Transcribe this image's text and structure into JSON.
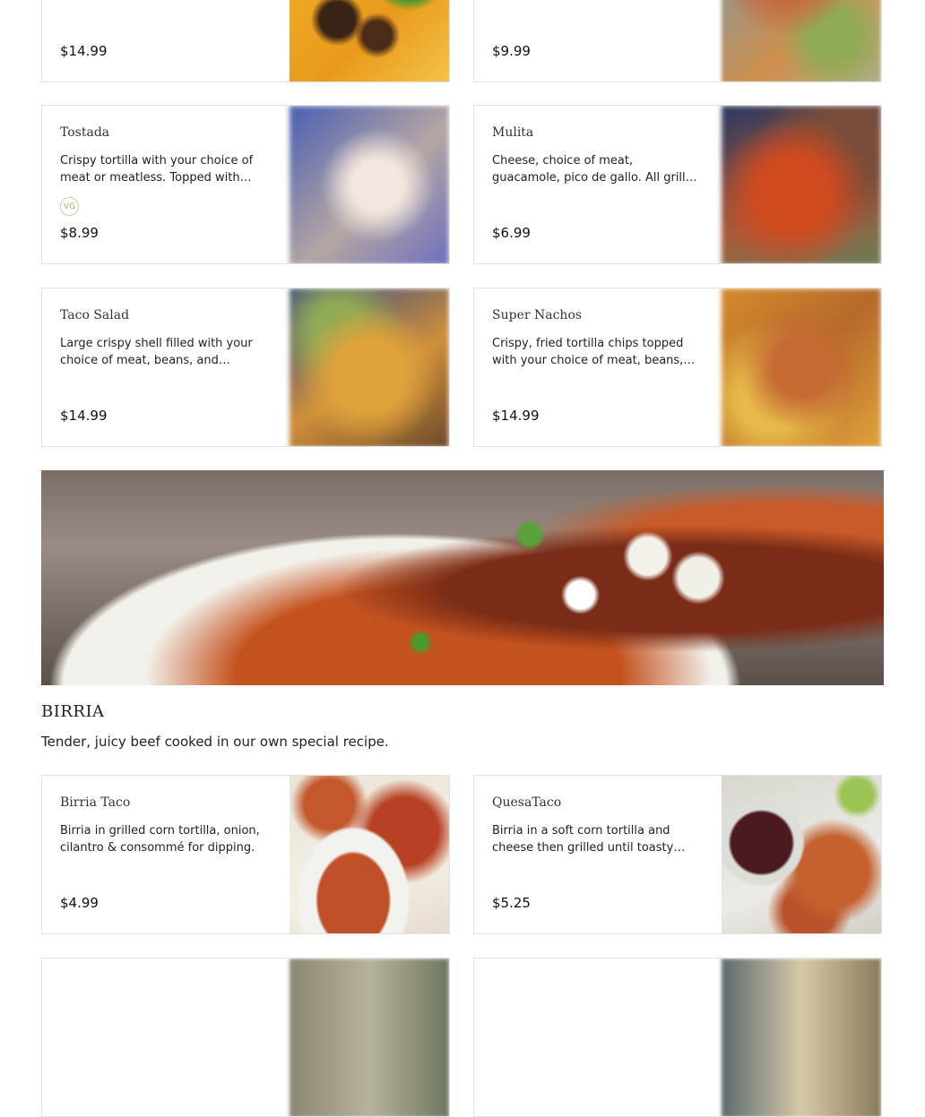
{
  "cards_top": [
    {
      "name": "",
      "description": "",
      "price": "$14.99",
      "image": "fries"
    },
    {
      "name": "",
      "description": "",
      "price": "$9.99",
      "image": "fade"
    }
  ],
  "cards_mid": [
    {
      "name": "Tostada",
      "description": "Crispy tortilla with your choice of meat or meatless. Topped with…",
      "badge": "VG",
      "price": "$8.99"
    },
    {
      "name": "Mulita",
      "description": "Cheese, choice of meat, guacamole, pico de gallo. All grilled between…",
      "price": "$6.99"
    },
    {
      "name": "Taco Salad",
      "description": "Large crispy shell filled with your choice of meat, beans, and topped…",
      "price": "$14.99"
    },
    {
      "name": "Super Nachos",
      "description": "Crispy, fried tortilla chips topped with your choice of meat, beans,…",
      "price": "$14.99"
    }
  ],
  "section": {
    "title": "BIRRIA",
    "description": "Tender, juicy beef cooked in our own special recipe."
  },
  "birria_cards": [
    {
      "name": "Birria Taco",
      "description": "Birria in grilled corn tortilla, onion, cilantro & consommé for dipping.",
      "price": "$4.99"
    },
    {
      "name": "QuesaTaco",
      "description": "Birria in a soft corn tortilla and cheese then grilled until toasty…",
      "price": "$5.25"
    }
  ]
}
